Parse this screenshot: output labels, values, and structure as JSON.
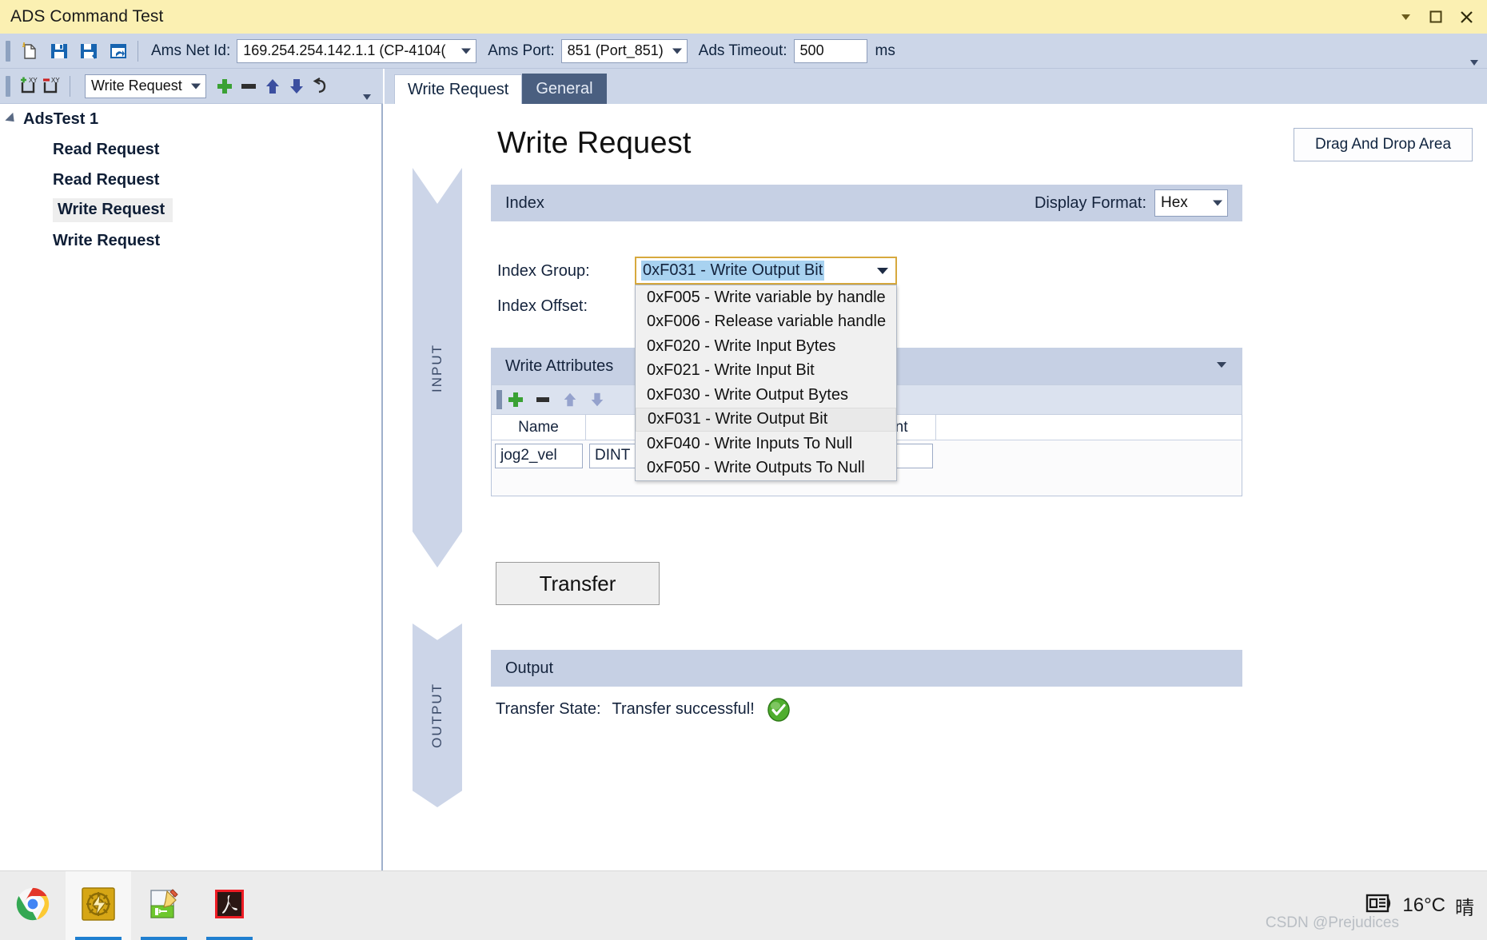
{
  "window": {
    "title": "ADS Command Test",
    "buttons": [
      {
        "name": "minimize-ribbon-button",
        "glyph": "▾"
      },
      {
        "name": "maximize-button",
        "glyph": "❐"
      },
      {
        "name": "close-button",
        "glyph": "✕"
      }
    ]
  },
  "toolbar": {
    "icons": [
      {
        "name": "new-document-icon",
        "label": "New"
      },
      {
        "name": "save-icon",
        "label": "Save"
      },
      {
        "name": "save-as-icon",
        "label": "Save As"
      },
      {
        "name": "load-icon",
        "label": "Load"
      }
    ],
    "ams_net_id_label": "Ams Net Id:",
    "ams_net_id_value": "169.254.254.142.1.1 (CP-4104(",
    "ams_port_label": "Ams Port:",
    "ams_port_value": "851 (Port_851)",
    "ads_timeout_label": "Ads Timeout:",
    "ads_timeout_value": "500",
    "ads_timeout_unit": "ms"
  },
  "tree_toolbar": {
    "add_icon": "add-request-icon",
    "remove_icon": "remove-request-icon",
    "request_type_value": "Write Request",
    "buttons": [
      {
        "name": "add-button",
        "glyph": "+"
      },
      {
        "name": "remove-button",
        "glyph": "–"
      },
      {
        "name": "move-up-button",
        "glyph": "↑"
      },
      {
        "name": "move-down-button",
        "glyph": "↓"
      },
      {
        "name": "undo-button",
        "glyph": "↺"
      }
    ]
  },
  "tree": {
    "root_label": "AdsTest 1",
    "items": [
      {
        "label": "Read Request",
        "selected": false
      },
      {
        "label": "Read Request",
        "selected": false
      },
      {
        "label": "Write Request",
        "selected": true
      },
      {
        "label": "Write Request",
        "selected": false
      }
    ]
  },
  "tabs": [
    {
      "label": "Write Request",
      "active": true
    },
    {
      "label": "General",
      "active": false
    }
  ],
  "page": {
    "title": "Write Request",
    "drag_drop_label": "Drag And Drop Area"
  },
  "flow": {
    "input_label": "INPUT",
    "output_label": "OUTPUT"
  },
  "index_section": {
    "header": "Index",
    "display_format_label": "Display Format:",
    "display_format_value": "Hex",
    "index_group_label": "Index Group:",
    "index_offset_label": "Index Offset:",
    "index_group_value": "0xF031 - Write Output Bit",
    "index_group_options": [
      {
        "label": "0xF005 - Write variable by handle",
        "highlighted": false
      },
      {
        "label": "0xF006 - Release variable handle",
        "highlighted": false
      },
      {
        "label": "0xF020 - Write Input Bytes",
        "highlighted": false
      },
      {
        "label": "0xF021 - Write Input Bit",
        "highlighted": false
      },
      {
        "label": "0xF030 - Write Output Bytes",
        "highlighted": false
      },
      {
        "label": "0xF031 - Write Output Bit",
        "highlighted": true
      },
      {
        "label": "0xF040 - Write Inputs To Null",
        "highlighted": false
      },
      {
        "label": "0xF050 - Write Outputs To Null",
        "highlighted": false
      }
    ]
  },
  "write_attributes": {
    "header": "Write Attributes",
    "toolbar_buttons": [
      {
        "name": "add-attribute-button",
        "glyph": "+"
      },
      {
        "name": "remove-attribute-button",
        "glyph": "–"
      },
      {
        "name": "move-attribute-up-button",
        "glyph": "↑"
      },
      {
        "name": "move-attribute-down-button",
        "glyph": "↓"
      }
    ],
    "columns": [
      "Name",
      "",
      "",
      "mment",
      ""
    ],
    "rows": [
      {
        "name": "jog2_vel",
        "type": "DINT",
        "value": "",
        "comment": ""
      }
    ]
  },
  "transfer": {
    "button_label": "Transfer"
  },
  "output_section": {
    "header": "Output",
    "state_label": "Transfer State:",
    "state_value": "Transfer successful!",
    "state_icon": "success-check-icon"
  },
  "taskbar": {
    "items": [
      {
        "name": "taskbar-chrome",
        "icon": "chrome-icon",
        "open": false,
        "active": false
      },
      {
        "name": "taskbar-twincat",
        "icon": "twincat-icon",
        "open": true,
        "active": true
      },
      {
        "name": "taskbar-notepad",
        "icon": "notepad-editor-icon",
        "open": true,
        "active": false
      },
      {
        "name": "taskbar-acrobat",
        "icon": "adobe-acrobat-icon",
        "open": true,
        "active": false
      }
    ],
    "weather_icon": "news-weather-icon",
    "weather_temp": "16°C",
    "weather_cond": "晴",
    "watermark": "CSDN @Prejudices"
  },
  "colors": {
    "title_bar": "#fbf0b2",
    "ribbon": "#ccd6e8",
    "section_header": "#c6d0e4",
    "accent_focus": "#d7a93e",
    "selection": "#a8d2f0",
    "success": "#46a832"
  }
}
